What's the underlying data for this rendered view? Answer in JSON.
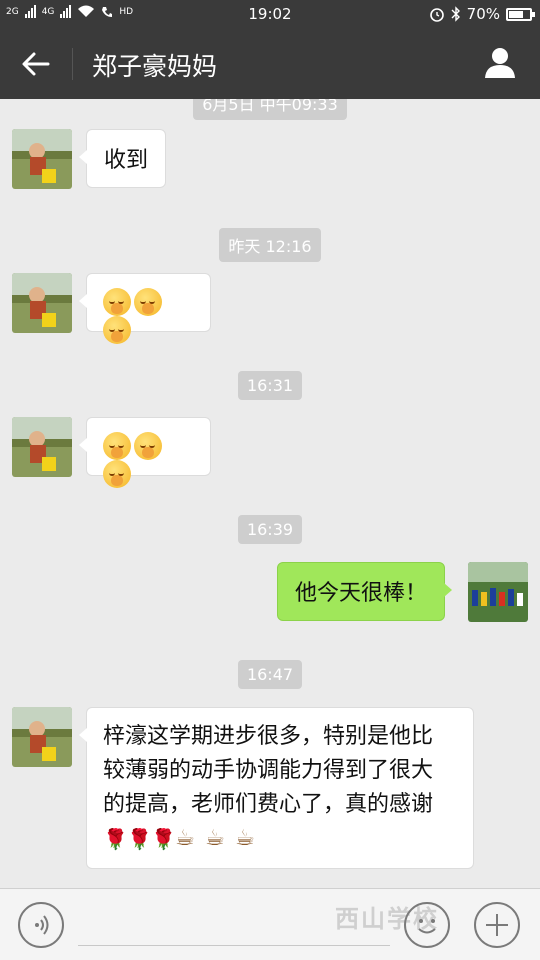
{
  "status_bar": {
    "net1": "2G",
    "net2": "4G",
    "hd": "HD",
    "time": "19:02",
    "battery": "70%",
    "battery_level": 0.7
  },
  "header": {
    "title": "郑子豪妈妈"
  },
  "messages": [
    {
      "type": "timestamp",
      "text": "6月5日 中午09:33"
    },
    {
      "type": "incoming",
      "text": "收到"
    },
    {
      "type": "timestamp",
      "text": "昨天 12:16"
    },
    {
      "type": "incoming",
      "emoji": [
        "hands-over-face",
        "hands-over-face",
        "hands-over-face"
      ]
    },
    {
      "type": "timestamp",
      "text": "16:31"
    },
    {
      "type": "incoming",
      "emoji": [
        "hands-over-face",
        "hands-over-face",
        "hands-over-face"
      ]
    },
    {
      "type": "timestamp",
      "text": "16:39"
    },
    {
      "type": "outgoing",
      "text": "他今天很棒！"
    },
    {
      "type": "timestamp",
      "text": "16:47"
    },
    {
      "type": "incoming",
      "text_lines": [
        "梓濠这学期进步很多，特别是他比",
        "较薄弱的动手协调能力得到了很大",
        "的提高，老师们费心了，真的感谢"
      ],
      "icons": [
        "rose",
        "rose",
        "rose",
        "coffee",
        "coffee",
        "coffee"
      ]
    }
  ],
  "watermark": "西山学校",
  "colors": {
    "header_bg": "#3a3a3a",
    "chat_bg": "#ebebeb",
    "outgoing_bubble": "#a0e75a",
    "timestamp_bg": "#cecece"
  }
}
